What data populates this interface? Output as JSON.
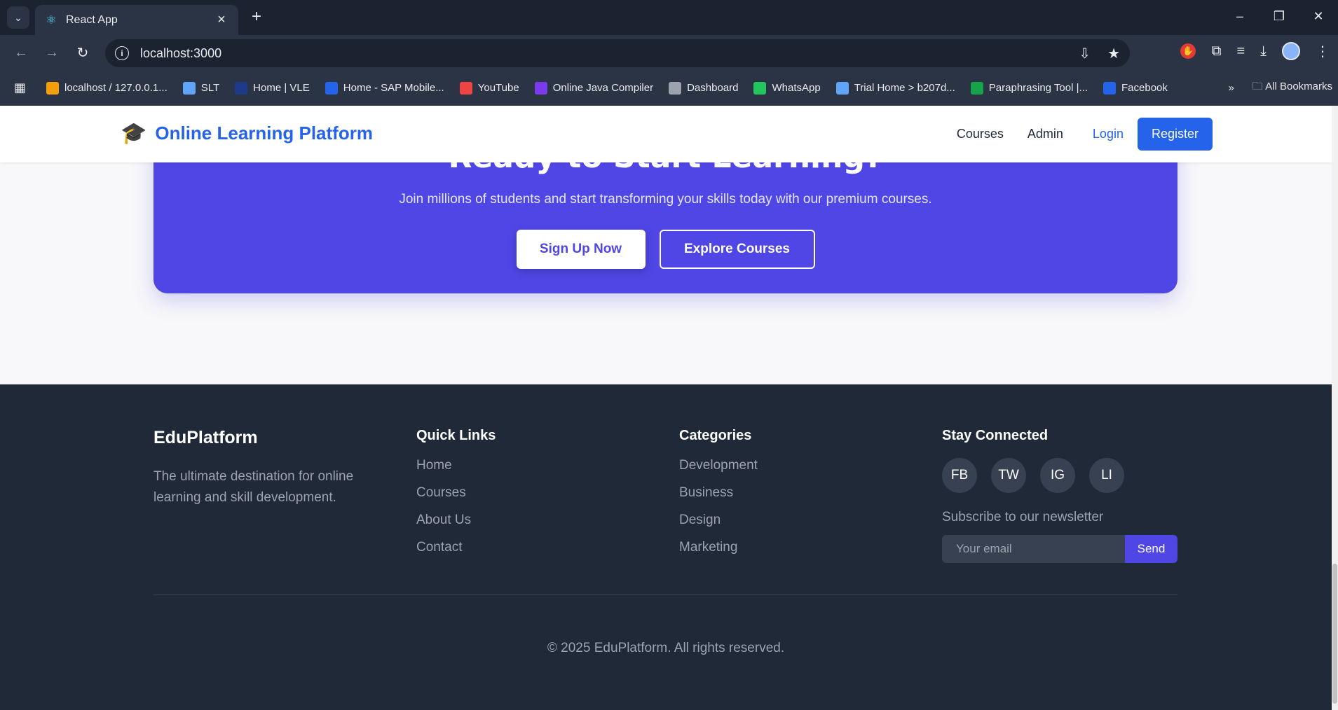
{
  "browser": {
    "tab_title": "React App",
    "url": "localhost:3000",
    "bookmarks": [
      {
        "label": "localhost / 127.0.0.1...",
        "color": "#f59e0b"
      },
      {
        "label": "SLT",
        "color": "#60a5fa"
      },
      {
        "label": "Home | VLE",
        "color": "#1e3a8a"
      },
      {
        "label": "Home - SAP Mobile...",
        "color": "#2563eb"
      },
      {
        "label": "YouTube",
        "color": "#ef4444"
      },
      {
        "label": "Online Java Compiler",
        "color": "#7c3aed"
      },
      {
        "label": "Dashboard",
        "color": "#9ca3af"
      },
      {
        "label": "WhatsApp",
        "color": "#22c55e"
      },
      {
        "label": "Trial Home > b207d...",
        "color": "#60a5fa"
      },
      {
        "label": "Paraphrasing Tool |...",
        "color": "#16a34a"
      },
      {
        "label": "Facebook",
        "color": "#2563eb"
      }
    ],
    "all_bookmarks": "All Bookmarks"
  },
  "nav": {
    "logo": "Online Learning Platform",
    "courses": "Courses",
    "admin": "Admin",
    "login": "Login",
    "register": "Register"
  },
  "cta": {
    "title": "Ready to Start Learning?",
    "subtitle": "Join millions of students and start transforming your skills today with our premium courses.",
    "signup": "Sign Up Now",
    "explore": "Explore Courses"
  },
  "footer": {
    "brand": "EduPlatform",
    "description": "The ultimate destination for online learning and skill development.",
    "quick_links_title": "Quick Links",
    "quick_links": [
      "Home",
      "Courses",
      "About Us",
      "Contact"
    ],
    "categories_title": "Categories",
    "categories": [
      "Development",
      "Business",
      "Design",
      "Marketing"
    ],
    "connect_title": "Stay Connected",
    "socials": [
      "FB",
      "TW",
      "IG",
      "LI"
    ],
    "newsletter_label": "Subscribe to our newsletter",
    "email_placeholder": "Your email",
    "send": "Send",
    "copyright": "© 2025 EduPlatform. All rights reserved."
  },
  "colors": {
    "primary": "#2563eb",
    "cta_bg": "#4f46e5",
    "footer_bg": "#1f2937"
  }
}
